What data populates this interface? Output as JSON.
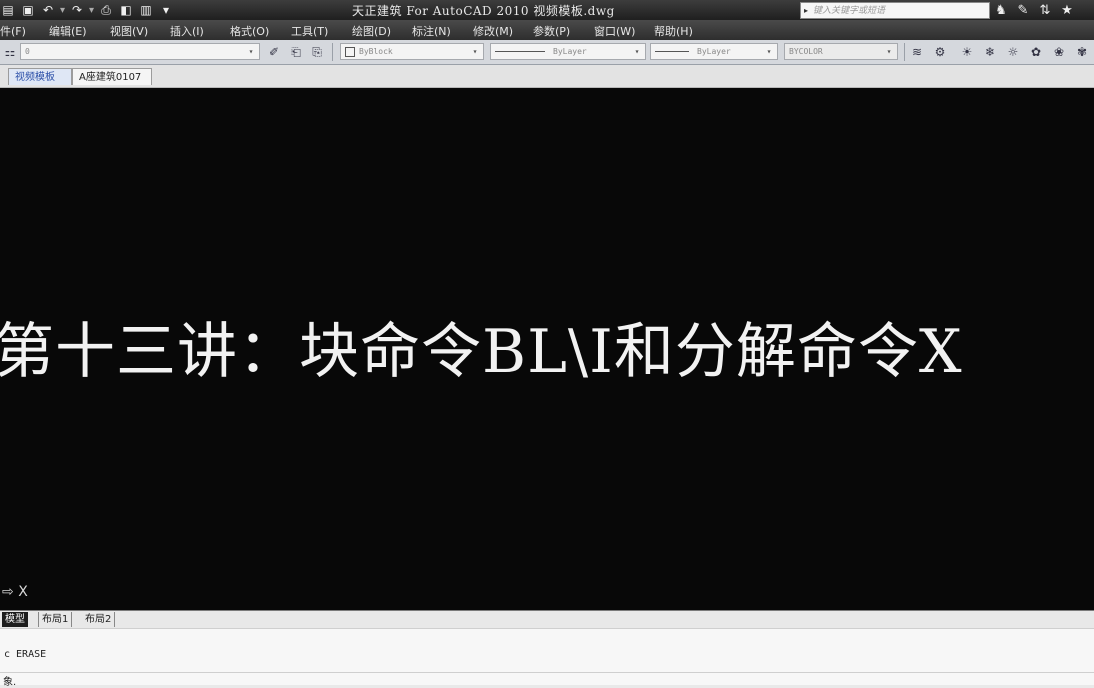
{
  "titlebar": {
    "title": "天正建筑 For AutoCAD 2010  视频模板.dwg",
    "search_placeholder": "键入关键字或短语",
    "quick_access": [
      "open-icon",
      "save-icon",
      "undo-icon",
      "redo-icon",
      "plot-icon",
      "publish-icon",
      "saveas-icon",
      "dropdown-icon"
    ],
    "right_icons": [
      "binoculars-icon",
      "wrench-icon",
      "exchange-icon",
      "star-icon"
    ]
  },
  "menu": [
    "件(F)",
    "编辑(E)",
    "视图(V)",
    "插入(I)",
    "格式(O)",
    "工具(T)",
    "绘图(D)",
    "标注(N)",
    "修改(M)",
    "参数(P)",
    "窗口(W)",
    "帮助(H)"
  ],
  "toolbar": {
    "layer_value": "0",
    "color_value": "ByBlock",
    "linetype_value": "ByLayer",
    "lineweight_value": "ByLayer",
    "plotstyle_value": "BYCOLOR"
  },
  "doc_tabs": [
    "视频模板",
    "A座建筑0107"
  ],
  "canvas": {
    "lecture_title": "第十三讲：块命令BL\\I和分解命令X",
    "ucs_label": "X"
  },
  "layout_tabs": [
    "模型",
    "布局1",
    "布局2"
  ],
  "command": {
    "line1": "c ERASE",
    "line2": "象."
  },
  "colors": {
    "canvas_bg": "#080808",
    "title_text": "#f2f2f2",
    "title_bar": "#2b2b2b"
  }
}
